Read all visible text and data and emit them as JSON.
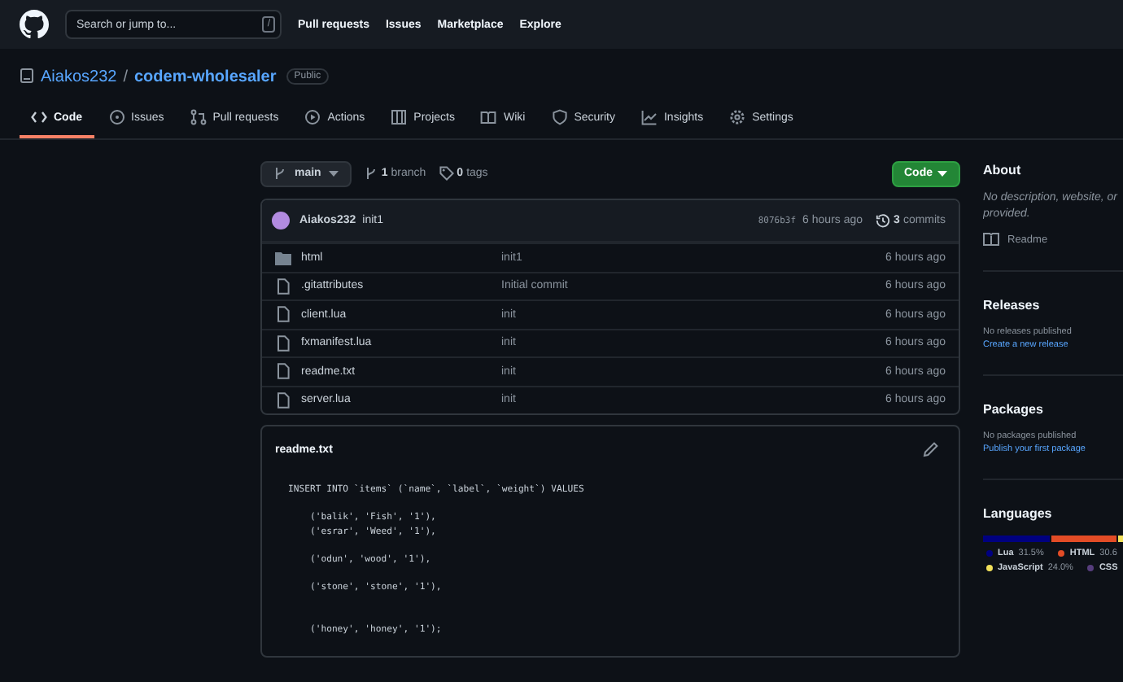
{
  "header": {
    "search": {
      "placeholder": "Search or jump to...",
      "shortcut": "/"
    },
    "nav": [
      "Pull requests",
      "Issues",
      "Marketplace",
      "Explore"
    ]
  },
  "repo": {
    "owner": "Aiakos232",
    "separator": "/",
    "name": "codem-wholesaler",
    "visibility": "Public"
  },
  "tabs": [
    {
      "label": "Code",
      "selected": true
    },
    {
      "label": "Issues",
      "selected": false
    },
    {
      "label": "Pull requests",
      "selected": false
    },
    {
      "label": "Actions",
      "selected": false
    },
    {
      "label": "Projects",
      "selected": false
    },
    {
      "label": "Wiki",
      "selected": false
    },
    {
      "label": "Security",
      "selected": false
    },
    {
      "label": "Insights",
      "selected": false
    },
    {
      "label": "Settings",
      "selected": false
    }
  ],
  "branch_bar": {
    "branch": "main",
    "branches_count": "1",
    "branches_label": "branch",
    "tags_count": "0",
    "tags_label": "tags",
    "code_button": "Code"
  },
  "commit": {
    "author": "Aiakos232",
    "message": "init1",
    "hash": "8076b3f",
    "time": "6 hours ago",
    "commits_count": "3",
    "commits_label": "commits"
  },
  "files": [
    {
      "kind": "folder",
      "name": "html",
      "message": "init1",
      "time": "6 hours ago"
    },
    {
      "kind": "file",
      "name": ".gitattributes",
      "message": "Initial commit",
      "time": "6 hours ago"
    },
    {
      "kind": "file",
      "name": "client.lua",
      "message": "init",
      "time": "6 hours ago"
    },
    {
      "kind": "file",
      "name": "fxmanifest.lua",
      "message": "init",
      "time": "6 hours ago"
    },
    {
      "kind": "file",
      "name": "readme.txt",
      "message": "init",
      "time": "6 hours ago"
    },
    {
      "kind": "file",
      "name": "server.lua",
      "message": "init",
      "time": "6 hours ago"
    }
  ],
  "readme": {
    "title": "readme.txt",
    "code": "INSERT INTO `items` (`name`, `label`, `weight`) VALUES\n\n    ('balik', 'Fish', '1'),\n    ('esrar', 'Weed', '1'),\n\n    ('odun', 'wood', '1'),\n\n    ('stone', 'stone', '1'),\n\n\n    ('honey', 'honey', '1');"
  },
  "sidebar": {
    "about": {
      "title": "About",
      "description": "No description, website, or provided.",
      "readme": "Readme"
    },
    "releases": {
      "title": "Releases",
      "note": "No releases published",
      "link": "Create a new release"
    },
    "packages": {
      "title": "Packages",
      "note": "No packages published",
      "link": "Publish your first package"
    },
    "languages": {
      "title": "Languages",
      "items": [
        {
          "name": "Lua",
          "percent": "31.5%",
          "color": "#000080"
        },
        {
          "name": "HTML",
          "percent": "30.6",
          "color": "#e34c26"
        },
        {
          "name": "JavaScript",
          "percent": "24.0%",
          "color": "#f1e05a"
        },
        {
          "name": "CSS",
          "color": "#563d7c"
        }
      ]
    }
  }
}
